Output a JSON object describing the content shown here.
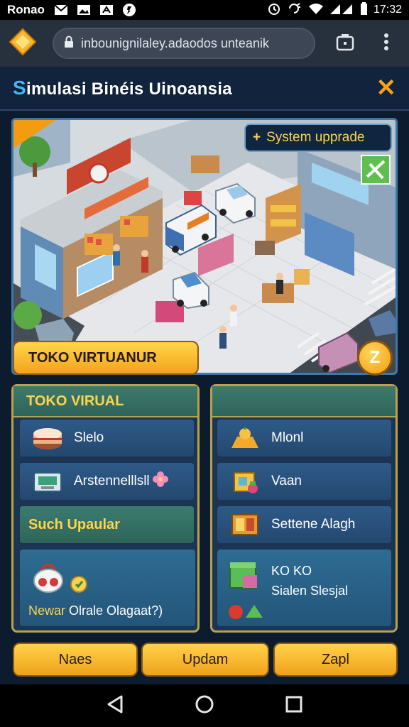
{
  "status": {
    "carrier": "Ronao",
    "time": "17:32"
  },
  "browser": {
    "url": "inbounignilaley.adaodos unteanik"
  },
  "header": {
    "title_first": "S",
    "title_rest": "imulasi Binéis Uinoansia"
  },
  "scene": {
    "upgrade_label": "System upprade",
    "banner_label": "TOKO VIRTUANUR",
    "level_label": "Z"
  },
  "left_panel": {
    "title": "TOKO VIRUAL",
    "items": [
      {
        "label": "Slelo",
        "icon": "cake-box-icon"
      },
      {
        "label": "Arstennelllsll",
        "icon": "cash-register-icon"
      }
    ],
    "sub_header": "Such Upaular",
    "feature": {
      "prefix": "Newar",
      "text": "Olrale Olagaat?)"
    }
  },
  "right_panel": {
    "items": [
      {
        "label": "Mlonl",
        "icon": "fruit-pile-icon"
      },
      {
        "label": "Vaan",
        "icon": "crate-icon"
      },
      {
        "label": "Settene Alagh",
        "icon": "shelf-box-icon"
      }
    ],
    "feature": {
      "line1": "KO KO",
      "line2": "Sialen Slesjal"
    }
  },
  "bottom_buttons": [
    "Naes",
    "Updam",
    "Zapl"
  ]
}
